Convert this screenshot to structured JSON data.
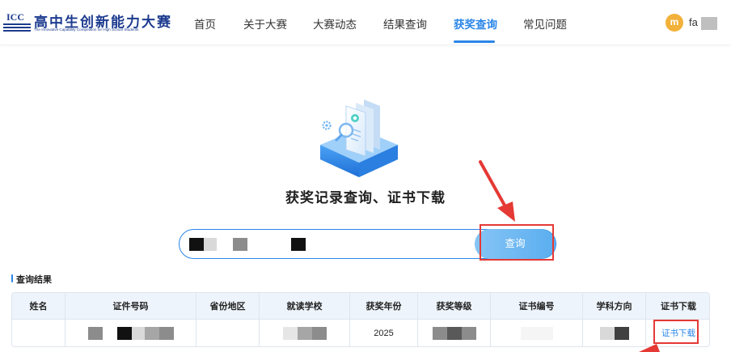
{
  "logo": {
    "mark": "ICC",
    "title": "高中生创新能力大赛",
    "subtitle": "The Innovative Capability Competition for High School Students"
  },
  "nav": {
    "items": [
      {
        "label": "首页",
        "active": false
      },
      {
        "label": "关于大赛",
        "active": false
      },
      {
        "label": "大赛动态",
        "active": false
      },
      {
        "label": "结果查询",
        "active": false
      },
      {
        "label": "获奖查询",
        "active": true
      },
      {
        "label": "常见问题",
        "active": false
      }
    ]
  },
  "user": {
    "avatar_letter": "m",
    "name_visible": "fa"
  },
  "main": {
    "title": "获奖记录查询、证书下载"
  },
  "search": {
    "button_label": "查询"
  },
  "results": {
    "title": "查询结果",
    "columns": [
      "姓名",
      "证件号码",
      "省份地区",
      "就读学校",
      "获奖年份",
      "获奖等级",
      "证书编号",
      "学科方向",
      "证书下载"
    ],
    "rows": [
      {
        "year": "2025",
        "download_label": "证书下载"
      }
    ]
  },
  "colors": {
    "accent": "#2a86e8",
    "brand": "#1d3b8f",
    "annotation": "#e53935",
    "avatar": "#f2b13a"
  }
}
